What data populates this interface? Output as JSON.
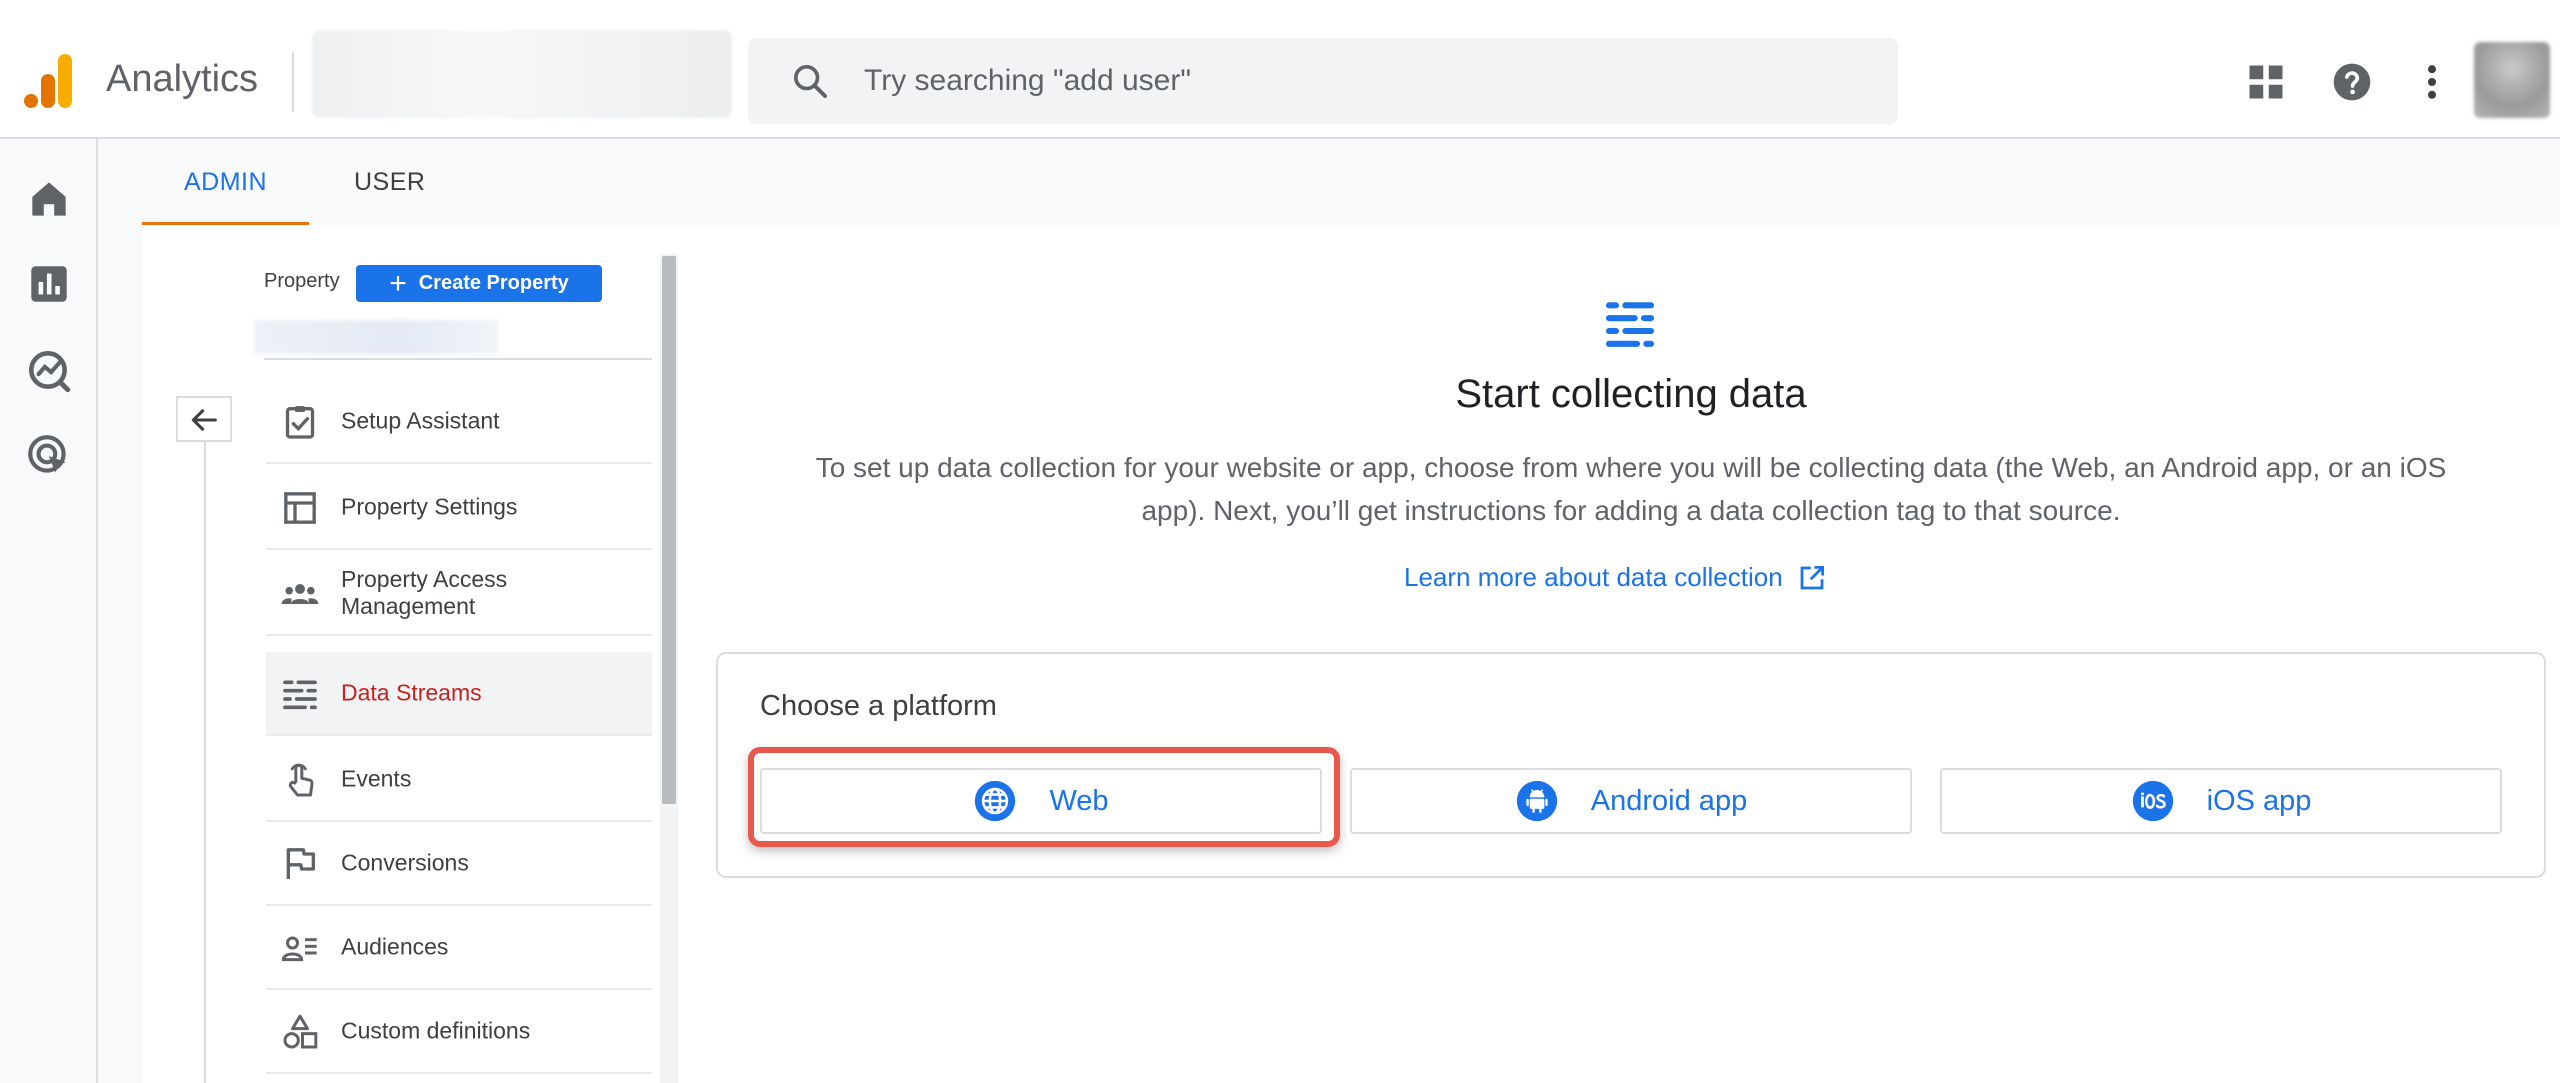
{
  "header": {
    "app_title": "Analytics",
    "search_placeholder": "Try searching \"add user\"",
    "icons": [
      "apps-grid-icon",
      "help-icon",
      "more-vert-icon",
      "avatar"
    ]
  },
  "rail": {
    "items": [
      "home-icon",
      "reports-icon",
      "explore-icon",
      "advertising-icon"
    ]
  },
  "tabs": [
    {
      "label": "ADMIN",
      "active": true
    },
    {
      "label": "USER",
      "active": false
    }
  ],
  "nav": {
    "section_label": "Property",
    "create_button": "Create Property",
    "items": [
      {
        "label": "Setup Assistant",
        "icon": "clipboard-check-icon"
      },
      {
        "label": "Property Settings",
        "icon": "layout-icon"
      },
      {
        "label": "Property Access Management",
        "icon": "people-icon"
      },
      {
        "label": "Data Streams",
        "icon": "data-streams-icon",
        "active": true
      },
      {
        "label": "Events",
        "icon": "touch-icon"
      },
      {
        "label": "Conversions",
        "icon": "flag-icon"
      },
      {
        "label": "Audiences",
        "icon": "audience-icon"
      },
      {
        "label": "Custom definitions",
        "icon": "shapes-icon"
      }
    ]
  },
  "main": {
    "title": "Start collecting data",
    "description": "To set up data collection for your website or app, choose from where you will be collecting data (the Web, an Android app, or an iOS app). Next, you’ll get instructions for adding a data collection tag to that source.",
    "learn_more": "Learn more about data collection",
    "platform_title": "Choose a platform",
    "platforms": [
      {
        "label": "Web",
        "icon": "globe-icon"
      },
      {
        "label": "Android app",
        "icon": "android-icon"
      },
      {
        "label": "iOS app",
        "icon": "ios-icon"
      }
    ]
  },
  "colors": {
    "accent": "#1a73e8",
    "active_nav": "#c5221f",
    "tab_underline": "#e8710a",
    "highlight": "#e8584b"
  }
}
